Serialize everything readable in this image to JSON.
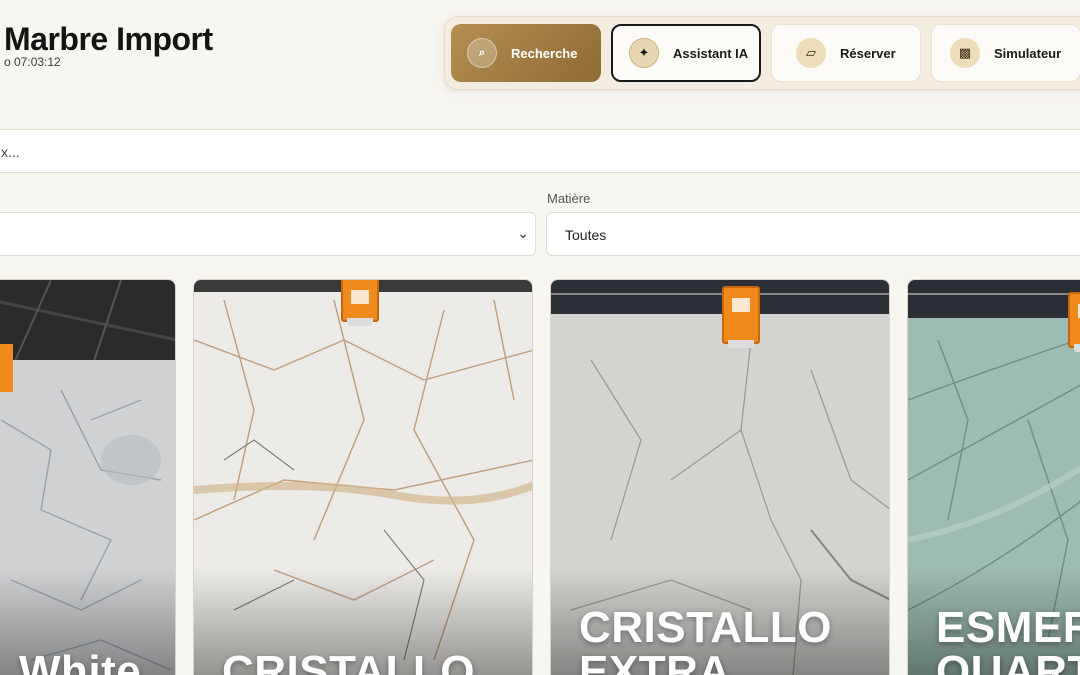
{
  "brand": {
    "title": "Marbre Import",
    "subtitle": "o 07:03:12"
  },
  "nav": {
    "search_label": "Recherche",
    "ai_label": "Assistant IA",
    "reserve_label": "Réserver",
    "sim_label": "Simulateur",
    "icons": {
      "search": "search-icon",
      "ai": "sparkle-icon",
      "reserve": "parallelogram-icon",
      "sim": "grid-icon"
    }
  },
  "search": {
    "placeholder": "x..."
  },
  "filters": {
    "material_label": "Matière",
    "material_value": "Toutes",
    "left_value": ""
  },
  "cards": [
    {
      "name": "White"
    },
    {
      "name": "CRISTALLO"
    },
    {
      "name": "CRISTALLO EXTRA"
    },
    {
      "name": "ESMER QUART"
    }
  ],
  "colors": {
    "accent": "#a07a40",
    "background": "#f8f6f1"
  }
}
